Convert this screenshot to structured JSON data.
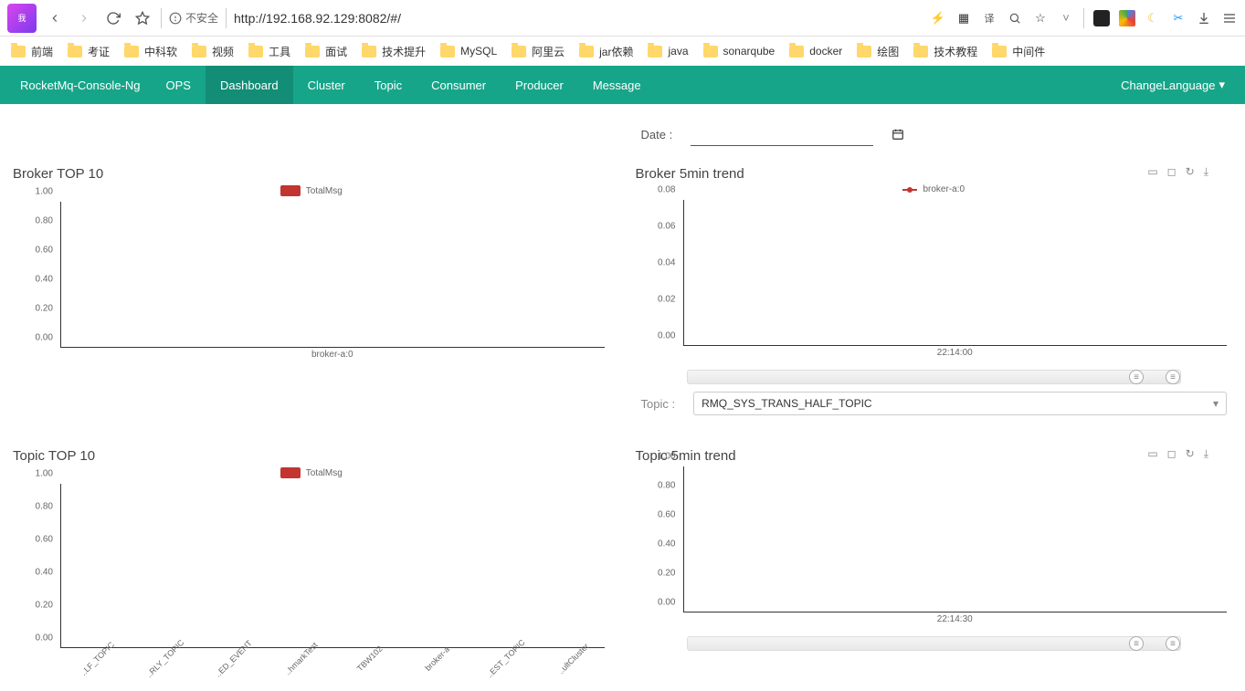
{
  "browser": {
    "insecure_label": "不安全",
    "url": "http://192.168.92.129:8082/#/"
  },
  "bookmarks": [
    "前端",
    "考证",
    "中科软",
    "视频",
    "工具",
    "面试",
    "技术提升",
    "MySQL",
    "阿里云",
    "jar依赖",
    "java",
    "sonarqube",
    "docker",
    "绘图",
    "技术教程",
    "中间件"
  ],
  "nav": {
    "brand": "RocketMq-Console-Ng",
    "items": [
      "OPS",
      "Dashboard",
      "Cluster",
      "Topic",
      "Consumer",
      "Producer",
      "Message"
    ],
    "active": "Dashboard",
    "language": "ChangeLanguage"
  },
  "date_label": "Date :",
  "topic_label": "Topic :",
  "topic_selected": "RMQ_SYS_TRANS_HALF_TOPIC",
  "panels": {
    "broker_top10": {
      "title": "Broker TOP 10",
      "legend": "TotalMsg"
    },
    "topic_top10": {
      "title": "Topic TOP 10",
      "legend": "TotalMsg"
    },
    "broker_trend": {
      "title": "Broker 5min trend",
      "legend": "broker-a:0"
    },
    "topic_trend": {
      "title": "Topic 5min trend"
    }
  },
  "chart_data": [
    {
      "id": "broker_top10",
      "type": "bar",
      "title": "Broker TOP 10",
      "series": [
        {
          "name": "TotalMsg",
          "values": [
            0
          ]
        }
      ],
      "categories": [
        "broker-a:0"
      ],
      "ylim": [
        0,
        1
      ],
      "yticks": [
        "0.00",
        "0.20",
        "0.40",
        "0.60",
        "0.80",
        "1.00"
      ]
    },
    {
      "id": "topic_top10",
      "type": "bar",
      "title": "Topic TOP 10",
      "series": [
        {
          "name": "TotalMsg",
          "values": [
            0,
            0,
            0,
            0,
            0,
            0,
            0,
            0
          ]
        }
      ],
      "categories": [
        "..LF_TOPIC",
        "..RLY_TOPIC",
        "..ED_EVENT",
        "..hmarkTest",
        "TBW102",
        "broker-a",
        "..EST_TOPIC",
        "..ultCluster"
      ],
      "ylim": [
        0,
        1
      ],
      "yticks": [
        "0.00",
        "0.20",
        "0.40",
        "0.60",
        "0.80",
        "1.00"
      ]
    },
    {
      "id": "broker_trend",
      "type": "line",
      "title": "Broker 5min trend",
      "series": [
        {
          "name": "broker-a:0",
          "values": [
            0
          ]
        }
      ],
      "x": [
        "22:14:00"
      ],
      "ylim": [
        0,
        0.08
      ],
      "yticks": [
        "0.00",
        "0.02",
        "0.04",
        "0.06",
        "0.08"
      ]
    },
    {
      "id": "topic_trend",
      "type": "line",
      "title": "Topic 5min trend",
      "series": [],
      "x": [
        "22:14:30"
      ],
      "ylim": [
        0,
        1
      ],
      "yticks": [
        "0.00",
        "0.20",
        "0.40",
        "0.60",
        "0.80",
        "1.00"
      ]
    }
  ]
}
